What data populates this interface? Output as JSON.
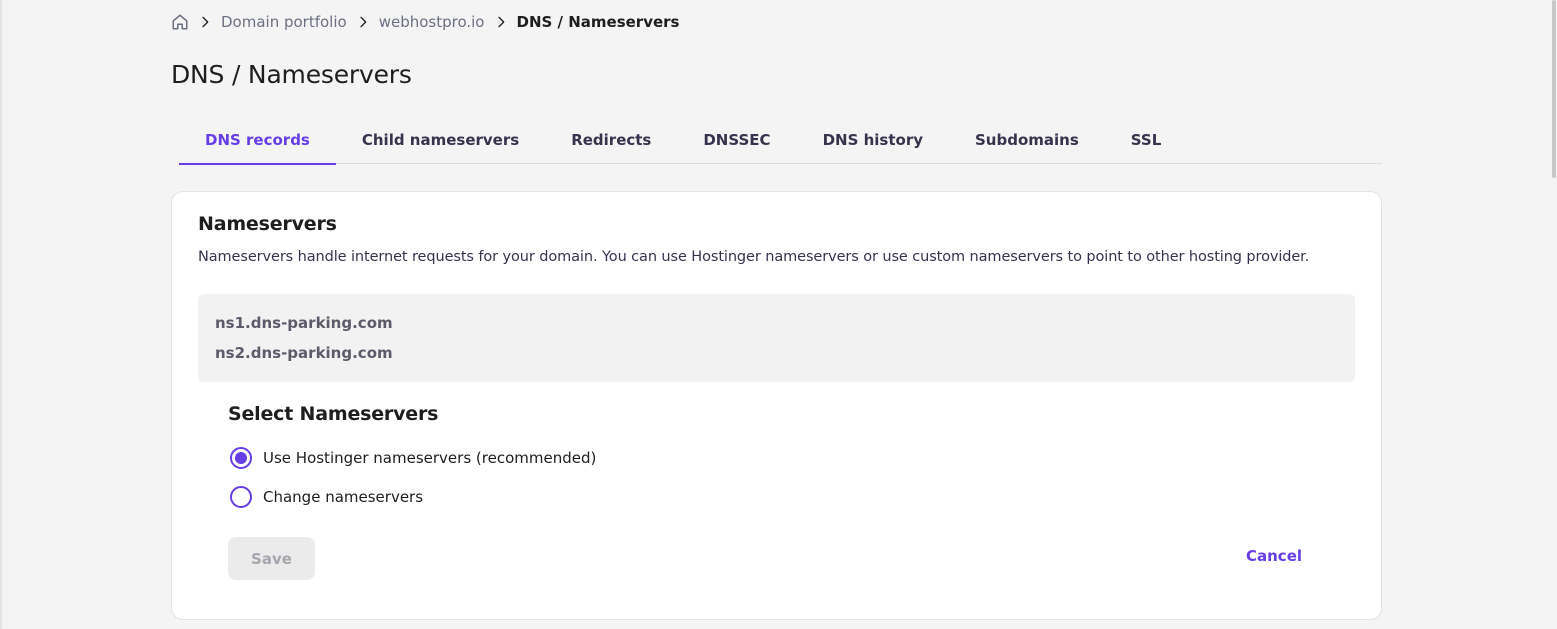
{
  "breadcrumb": {
    "home_icon": "home-icon",
    "items": [
      "Domain portfolio",
      "webhostpro.io"
    ],
    "current": "DNS / Nameservers"
  },
  "page": {
    "title": "DNS / Nameservers"
  },
  "tabs": [
    {
      "label": "DNS records",
      "active": true
    },
    {
      "label": "Child nameservers"
    },
    {
      "label": "Redirects"
    },
    {
      "label": "DNSSEC"
    },
    {
      "label": "DNS history"
    },
    {
      "label": "Subdomains"
    },
    {
      "label": "SSL"
    }
  ],
  "nameservers": {
    "title": "Nameservers",
    "description": "Nameservers handle internet requests for your domain. You can use Hostinger nameservers or use custom nameservers to point to other hosting provider.",
    "current": [
      "ns1.dns-parking.com",
      "ns2.dns-parking.com"
    ],
    "select_title": "Select Nameservers",
    "options": [
      {
        "label": "Use Hostinger nameservers (recommended)",
        "selected": true
      },
      {
        "label": "Change nameservers",
        "selected": false
      }
    ],
    "save_label": "Save",
    "cancel_label": "Cancel"
  },
  "colors": {
    "accent": "#673de6",
    "background": "#f4f4f4",
    "card": "#ffffff",
    "text": "#1d1e20",
    "muted": "#6d7081"
  }
}
